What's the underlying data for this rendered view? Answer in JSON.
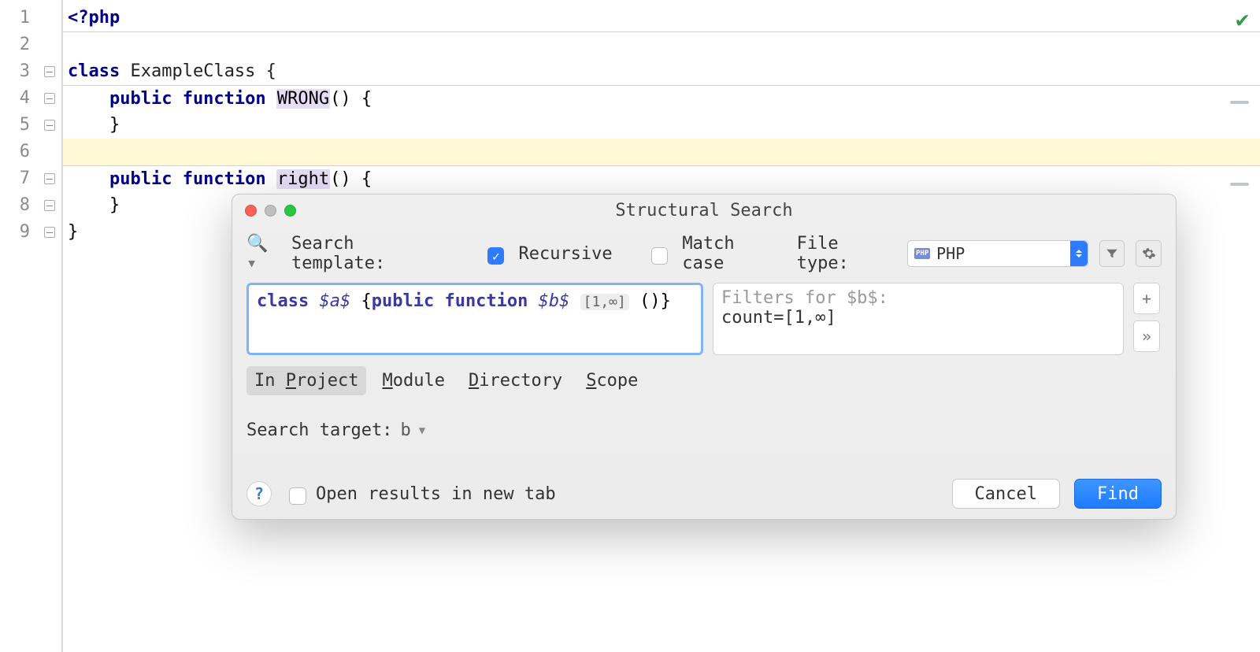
{
  "editor": {
    "lines": [
      "1",
      "2",
      "3",
      "4",
      "5",
      "6",
      "7",
      "8",
      "9"
    ],
    "code": {
      "l1a": "<?php",
      "l3a": "class ",
      "l3b": "ExampleClass {",
      "l4a": "    public function ",
      "l4b": "WRONG",
      "l4c": "() {",
      "l5": "    }",
      "l7a": "    public function ",
      "l7b": "right",
      "l7c": "() {",
      "l8": "    }",
      "l9": "}"
    }
  },
  "dialog": {
    "title": "Structural Search",
    "search_template_label": "Search template:",
    "recursive_label": "Recursive",
    "match_case_label": "Match case",
    "file_type_label": "File type:",
    "file_type_value": "PHP",
    "query": {
      "kw1": "class ",
      "v1": "$a$",
      "mid": " {",
      "kw2": "public function ",
      "v2": "$b$",
      "range": "[1,∞]",
      "tail": " ()}"
    },
    "filters_placeholder": "Filters for $b$:",
    "filters_value": "count=[1,∞]",
    "scope": {
      "in_project_pre": "In ",
      "in_project_u": "P",
      "in_project_post": "roject",
      "module_u": "M",
      "module_post": "odule",
      "directory_u": "D",
      "directory_post": "irectory",
      "scope_u": "S",
      "scope_post": "cope"
    },
    "search_target_label": "Search target:",
    "search_target_value": "b",
    "open_results_label": "Open results in new tab",
    "cancel": "Cancel",
    "find": "Find"
  }
}
